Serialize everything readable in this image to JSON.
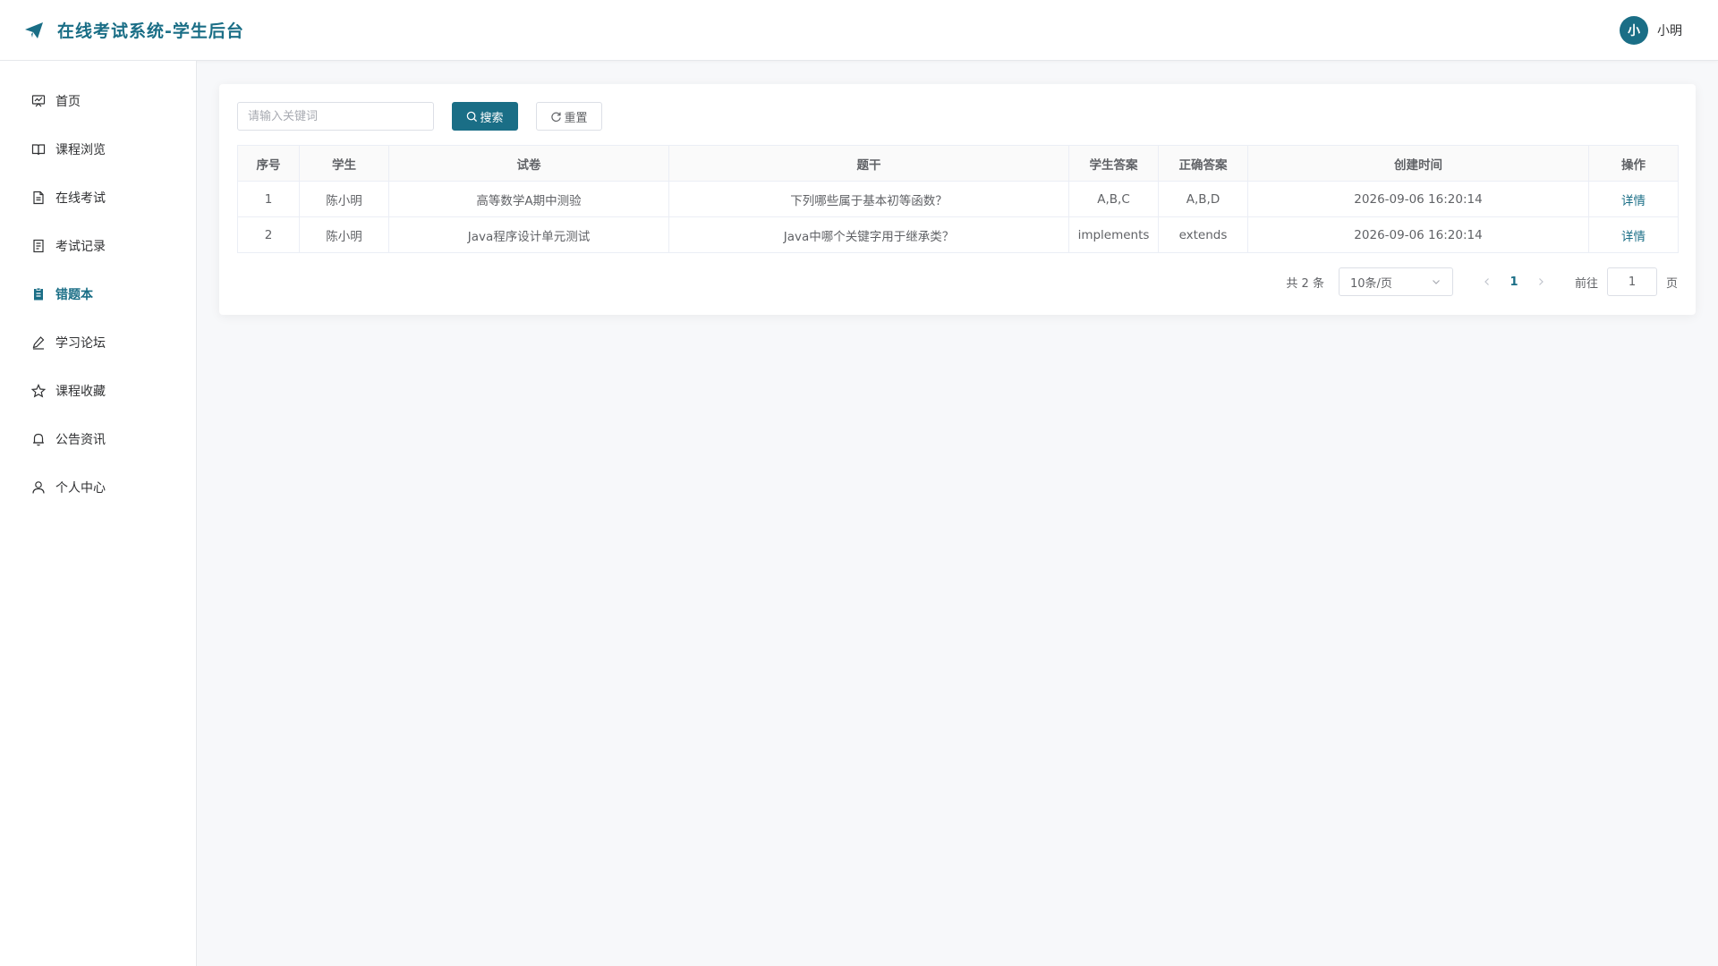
{
  "header": {
    "title": "在线考试系统-学生后台",
    "brand_icon": "paper-plane-icon",
    "user": {
      "avatar_text": "小",
      "name": "小明"
    }
  },
  "colors": {
    "accent": "#1a6e86",
    "border": "#ebeef5",
    "background": "#f7f8fa"
  },
  "sidebar": {
    "items": [
      {
        "label": "首页",
        "icon": "dashboard-icon"
      },
      {
        "label": "课程浏览",
        "icon": "book-icon"
      },
      {
        "label": "在线考试",
        "icon": "document-icon"
      },
      {
        "label": "考试记录",
        "icon": "record-icon"
      },
      {
        "label": "错题本",
        "icon": "notebook-icon",
        "active": true
      },
      {
        "label": "学习论坛",
        "icon": "edit-icon"
      },
      {
        "label": "课程收藏",
        "icon": "star-icon"
      },
      {
        "label": "公告资讯",
        "icon": "bell-icon"
      },
      {
        "label": "个人中心",
        "icon": "user-icon"
      }
    ]
  },
  "toolbar": {
    "search_placeholder": "请输入关键词",
    "search_value": "",
    "search_label": "搜索",
    "reset_label": "重置"
  },
  "table": {
    "columns": [
      "序号",
      "学生",
      "试卷",
      "题干",
      "学生答案",
      "正确答案",
      "创建时间",
      "操作"
    ],
    "rows": [
      [
        "1",
        "陈小明",
        "高等数学A期中测验",
        "下列哪些属于基本初等函数？",
        "A,B,C",
        "A,B,D",
        "2026-09-06 16:20:14",
        "详情"
      ],
      [
        "2",
        "陈小明",
        "Java程序设计单元测试",
        "Java中哪个关键字用于继承类？",
        "implements",
        "extends",
        "2026-09-06 16:20:14",
        "详情"
      ]
    ]
  },
  "pagination": {
    "total_text": "共 2 条",
    "page_size": "10条/页",
    "current_page": "1",
    "goto_label": "前往",
    "goto_value": "1",
    "goto_suffix": "页"
  }
}
